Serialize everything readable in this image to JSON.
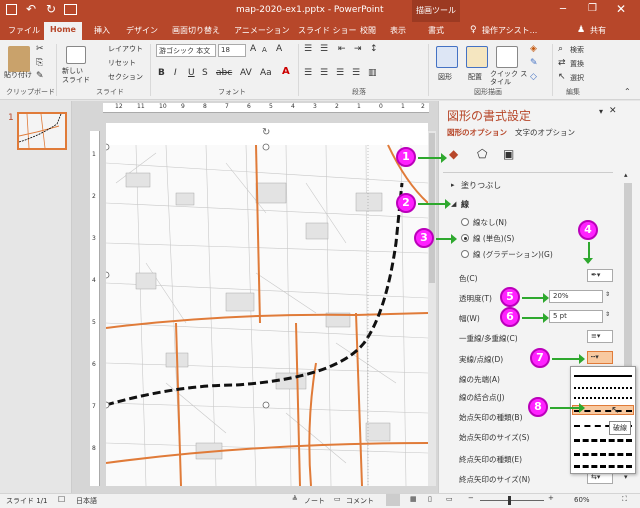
{
  "titlebar": {
    "title": "map-2020-ex1.pptx - PowerPoint",
    "context_tab": "描画ツール",
    "window_controls": [
      "minimize-icon",
      "restore-icon",
      "close-icon"
    ]
  },
  "tabs": [
    {
      "label": "ファイル"
    },
    {
      "label": "Home"
    },
    {
      "label": "挿入"
    },
    {
      "label": "デザイン"
    },
    {
      "label": "画面切り替え"
    },
    {
      "label": "アニメーション"
    },
    {
      "label": "スライド ショー"
    },
    {
      "label": "校閲"
    },
    {
      "label": "表示"
    },
    {
      "label": "書式"
    }
  ],
  "tell_me": "操作アシスト...",
  "share": "共有",
  "ribbon": {
    "paste": "貼り付け",
    "clipboard": "クリップボード",
    "new_slide": "新しい スライド",
    "layout": "レイアウト",
    "reset": "リセット",
    "section": "セクション",
    "slides": "スライド",
    "font_name": "游ゴシック 本文",
    "font_size": "18",
    "font": "フォント",
    "paragraph": "段落",
    "shapes": "図形",
    "arrange": "配置",
    "quick_styles": "クイック スタイル",
    "drawing": "図形描画",
    "find": "検索",
    "replace": "置換",
    "select": "選択",
    "editing": "編集"
  },
  "thumb_number": "1",
  "ruler": {
    "top": [
      "12",
      "11",
      "10",
      "9",
      "8",
      "7",
      "6",
      "5",
      "4",
      "3",
      "2",
      "1",
      "0",
      "1",
      "2"
    ],
    "left": [
      "1",
      "2",
      "3",
      "4",
      "5",
      "6",
      "7",
      "8"
    ]
  },
  "panel": {
    "title": "図形の書式設定",
    "tab_shape": "図形のオプション",
    "tab_text": "文字のオプション",
    "fill_header": "塗りつぶし",
    "line_header": "線",
    "radio_none": "線なし(N)",
    "radio_solid": "線 (単色)(S)",
    "radio_gradient": "線 (グラデーション)(G)",
    "color": "色(C)",
    "transparency": "透明度(T)",
    "transparency_value": "20%",
    "width": "幅(W)",
    "width_value": "5 pt",
    "compound": "一重線/多重線(C)",
    "dash": "実線/点線(D)",
    "cap": "線の先端(A)",
    "cap_value": "フラ",
    "join": "線の結合点(J)",
    "join_value": "角",
    "begin_arrow_type": "始点矢印の種類(B)",
    "begin_arrow_size": "始点矢印のサイズ(S)",
    "end_arrow_type": "終点矢印の種類(E)",
    "end_arrow_size": "終点矢印のサイズ(N)",
    "tooltip": "破線"
  },
  "badges": [
    "1",
    "2",
    "3",
    "4",
    "5",
    "6",
    "7",
    "8"
  ],
  "status": {
    "slide": "スライド 1/1",
    "language": "日本語",
    "notes": "ノート",
    "comments": "コメント",
    "zoom": "60%"
  },
  "colors": {
    "accent": "#b7472a",
    "callout": "#ff22ff",
    "arrow": "#2ea82e",
    "road": "#e07b39"
  }
}
